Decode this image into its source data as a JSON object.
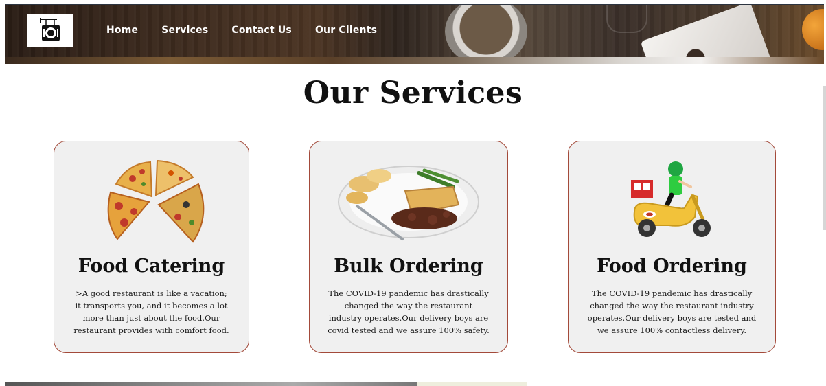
{
  "header": {
    "logo_icon": "restaurant-sign-icon",
    "nav": [
      {
        "label": "Home"
      },
      {
        "label": "Services"
      },
      {
        "label": "Contact Us"
      },
      {
        "label": "Our Clients"
      }
    ]
  },
  "main": {
    "title": "Our Services",
    "cards": [
      {
        "title": "Food Catering",
        "image_icon": "pizza-slices-icon",
        "description": ">A good restaurant is like a vacation; it transports you, and it becomes a lot more than just about the food.Our restaurant provides with comfort food."
      },
      {
        "title": "Bulk Ordering",
        "image_icon": "meal-plate-icon",
        "description": "The COVID-19 pandemic has drastically changed the way the restaurant industry operates.Our delivery boys are covid tested and we assure 100% safety."
      },
      {
        "title": "Food Ordering",
        "image_icon": "delivery-scooter-icon",
        "description": "The COVID-19 pandemic has drastically changed the way the restaurant industry operates.Our delivery boys are tested and we assure 100% contactless delivery."
      }
    ]
  },
  "colors": {
    "card_border": "#a34a3a",
    "card_background": "#f0f0f0",
    "nav_text": "#ffffff"
  }
}
